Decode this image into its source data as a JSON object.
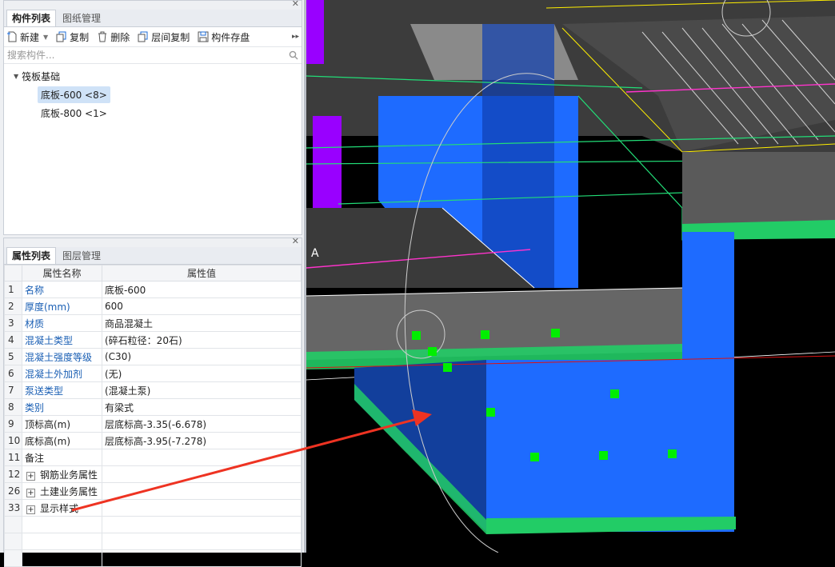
{
  "component_panel": {
    "tabs": [
      "构件列表",
      "图纸管理"
    ],
    "toolbar": {
      "new_label": "新建",
      "copy_label": "复制",
      "delete_label": "删除",
      "floor_copy_label": "层间复制",
      "save_label": "构件存盘"
    },
    "search_placeholder": "搜索构件...",
    "tree": {
      "group": "筏板基础",
      "items": [
        "底板-600 <8>",
        "底板-800 <1>"
      ]
    }
  },
  "property_panel": {
    "tabs": [
      "属性列表",
      "图层管理"
    ],
    "header": {
      "name": "属性名称",
      "value": "属性值"
    },
    "rows": [
      {
        "num": "1",
        "name": "名称",
        "value": "底板-600",
        "blue": true
      },
      {
        "num": "2",
        "name": "厚度(mm)",
        "value": "600",
        "blue": true
      },
      {
        "num": "3",
        "name": "材质",
        "value": "商品混凝土",
        "blue": true
      },
      {
        "num": "4",
        "name": "混凝土类型",
        "value": "(碎石粒径：20石)",
        "blue": true
      },
      {
        "num": "5",
        "name": "混凝土强度等级",
        "value": "(C30)",
        "blue": true
      },
      {
        "num": "6",
        "name": "混凝土外加剂",
        "value": "(无)",
        "blue": true
      },
      {
        "num": "7",
        "name": "泵送类型",
        "value": "(混凝土泵)",
        "blue": true
      },
      {
        "num": "8",
        "name": "类别",
        "value": "有梁式",
        "blue": true
      },
      {
        "num": "9",
        "name": "顶标高(m)",
        "value": "层底标高-3.35(-6.678)",
        "blue": false
      },
      {
        "num": "10",
        "name": "底标高(m)",
        "value": "层底标高-3.95(-7.278)",
        "blue": false
      },
      {
        "num": "11",
        "name": "备注",
        "value": "",
        "blue": false
      }
    ],
    "groups": [
      {
        "num": "12",
        "name": "钢筋业务属性"
      },
      {
        "num": "26",
        "name": "土建业务属性"
      },
      {
        "num": "33",
        "name": "显示样式"
      }
    ]
  },
  "viewport": {
    "axis_label": "A",
    "colors": {
      "blue": "#1e6bff",
      "green": "#22dd77",
      "grey": "#5a5a5a",
      "yellow": "#ffee00",
      "purple": "#9900ff",
      "arrow": "#ee3322"
    }
  }
}
